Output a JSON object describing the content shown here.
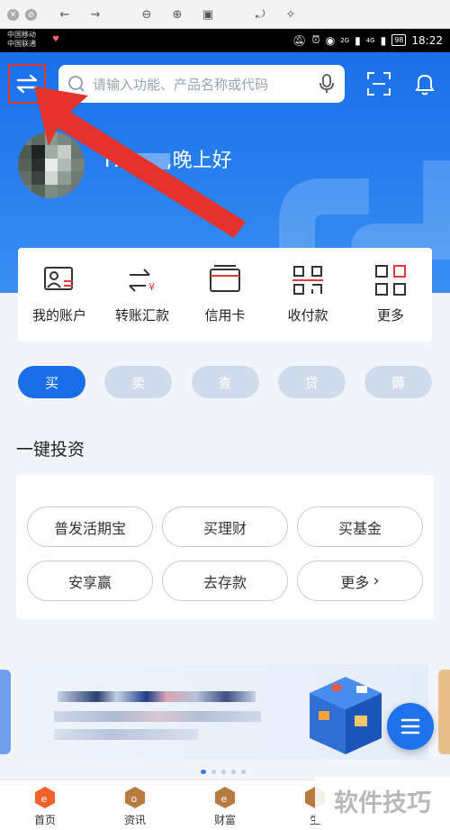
{
  "status_bar": {
    "carrier_1": "中国移动",
    "carrier_2": "中国联通",
    "network_1": "2G",
    "network_2": "4G",
    "battery": "98",
    "time": "18:22"
  },
  "header": {
    "search_placeholder": "请输入功能、产品名称或代码",
    "greeting_prefix": "Hi",
    "greeting_suffix": ",晚上好"
  },
  "quick_actions": [
    {
      "label": "我的账户",
      "icon": "account-card-icon"
    },
    {
      "label": "转账汇款",
      "icon": "transfer-yuan-icon"
    },
    {
      "label": "信用卡",
      "icon": "credit-card-icon"
    },
    {
      "label": "收付款",
      "icon": "qr-code-icon"
    },
    {
      "label": "更多",
      "icon": "grid-more-icon"
    }
  ],
  "tabs": [
    {
      "label": "买",
      "active": true
    },
    {
      "label": "卖",
      "active": false
    },
    {
      "label": "查",
      "active": false
    },
    {
      "label": "贷",
      "active": false
    },
    {
      "label": "薅",
      "active": false
    }
  ],
  "invest": {
    "title": "一键投资",
    "options": [
      "普发活期宝",
      "买理财",
      "买基金",
      "安享赢",
      "去存款",
      "更多"
    ]
  },
  "bottom_nav": [
    {
      "label": "首页",
      "active": true
    },
    {
      "label": "资讯",
      "active": false
    },
    {
      "label": "财富",
      "active": false
    },
    {
      "label": "生",
      "active": false
    }
  ],
  "watermark": "软件技巧",
  "colors": {
    "brand_blue": "#1a6fe8",
    "highlight_red": "#e03a2f",
    "tab_inactive": "#d0dcec"
  }
}
